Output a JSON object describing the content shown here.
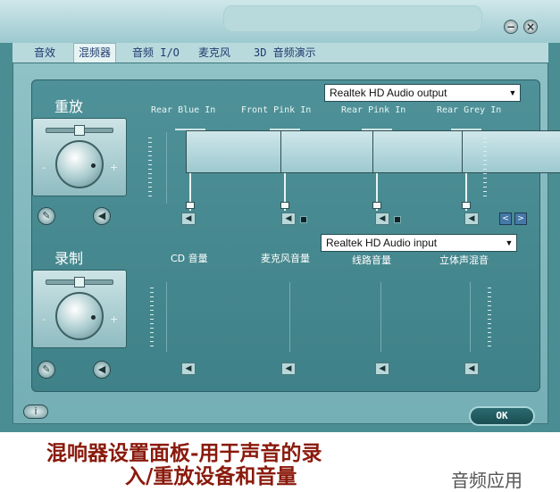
{
  "tabs": [
    "音效",
    "混频器",
    "音频 I/O",
    "麦克风",
    "3D 音频演示"
  ],
  "active_tab": "混频器",
  "window_controls": {
    "minimize": "−",
    "close": "×"
  },
  "playback": {
    "title": "重放",
    "device": "Realtek HD Audio output",
    "channels": [
      "Rear Blue In",
      "Front Pink In",
      "Rear Pink In",
      "Rear Grey In"
    ],
    "minus": "-",
    "plus": "+"
  },
  "record": {
    "title": "录制",
    "device": "Realtek HD Audio input",
    "channels": [
      "CD 音量",
      "麦克风音量",
      "线路音量",
      "立体声混音"
    ],
    "minus": "-",
    "plus": "+"
  },
  "buttons": {
    "ok": "OK",
    "info": "i",
    "prev": "<",
    "next": ">"
  },
  "caption": {
    "line1": "混响器设置面板-用于声音的录",
    "line2": "入/重放设备和音量"
  },
  "watermark": "音频应用",
  "icons": {
    "speaker": "speaker-icon",
    "wrench": "settings-icon",
    "info": "info-icon"
  }
}
